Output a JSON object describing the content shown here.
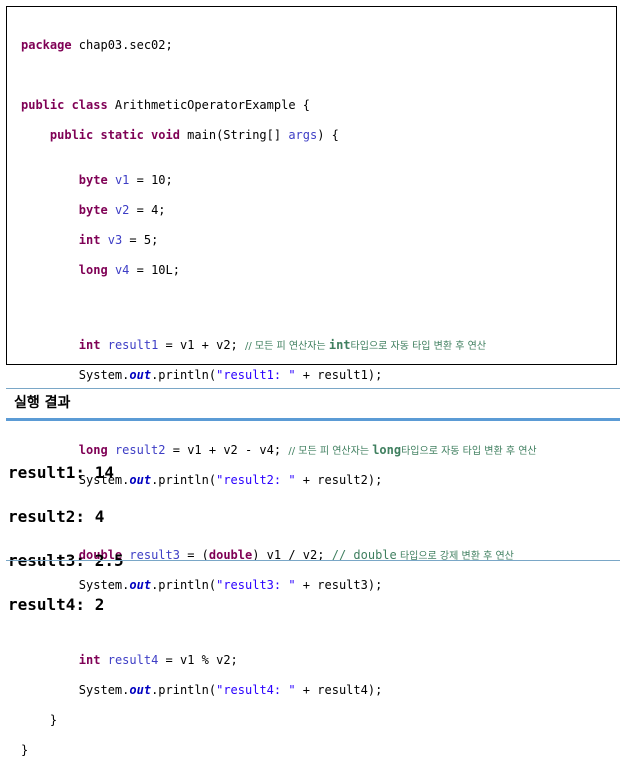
{
  "code": {
    "package_kw": "package",
    "package_name": " chap03.sec02;",
    "class_line": {
      "kw": "public class",
      "rest": " ArithmeticOperatorExample {"
    },
    "main_line": {
      "kw": "public static void",
      "rest1": " main(String[] ",
      "param": "args",
      "rest2": ") {"
    },
    "decl": [
      {
        "type": "byte",
        "name": "v1",
        "value": " = 10;"
      },
      {
        "type": "byte",
        "name": "v2",
        "value": " = 4;"
      },
      {
        "type": "int",
        "name": "v3",
        "value": " = 5;"
      },
      {
        "type": "long",
        "name": "v4",
        "value": " = 10L;"
      }
    ],
    "ops": [
      {
        "type": "int",
        "name": "result1",
        "expr": " = v1 + v2; ",
        "comment_pre": "// 모든 피 연산자는 ",
        "comment_kw": "int",
        "comment_post": "타입으로 자동 타입 변환 후 연산",
        "str": "\"result1: \"",
        "print_var": "result1"
      },
      {
        "type": "long",
        "name": "result2",
        "expr": " = v1 + v2 - v4; ",
        "comment_pre": "// 모든 피 연산자는 ",
        "comment_kw": "long",
        "comment_post": "타입으로 자동 타입 변환 후 연산",
        "str": "\"result2: \"",
        "print_var": "result2"
      },
      {
        "type": "double",
        "name": "result3",
        "expr_pre": " = (",
        "cast_kw": "double",
        "expr_post": ") v1 / v2; ",
        "comment_pre": "// ",
        "comment_kw": "double",
        "comment_post": " 타입으로 강제 변환 후 연산",
        "str": "\"result3: \"",
        "print_var": "result3"
      },
      {
        "type": "int",
        "name": "result4",
        "expr": " = v1 % v2;",
        "str": "\"result4: \"",
        "print_var": "result4"
      }
    ],
    "println_pre": "System.",
    "println_out": "out",
    "println_mid": ".println(",
    "println_plus": " + ",
    "println_end": ");",
    "close_method": "}",
    "close_class": "}"
  },
  "result_section": {
    "title": "실행 결과",
    "lines": [
      "result1: 14",
      "result2: 4",
      "result3: 2.5",
      "result4: 2"
    ]
  }
}
